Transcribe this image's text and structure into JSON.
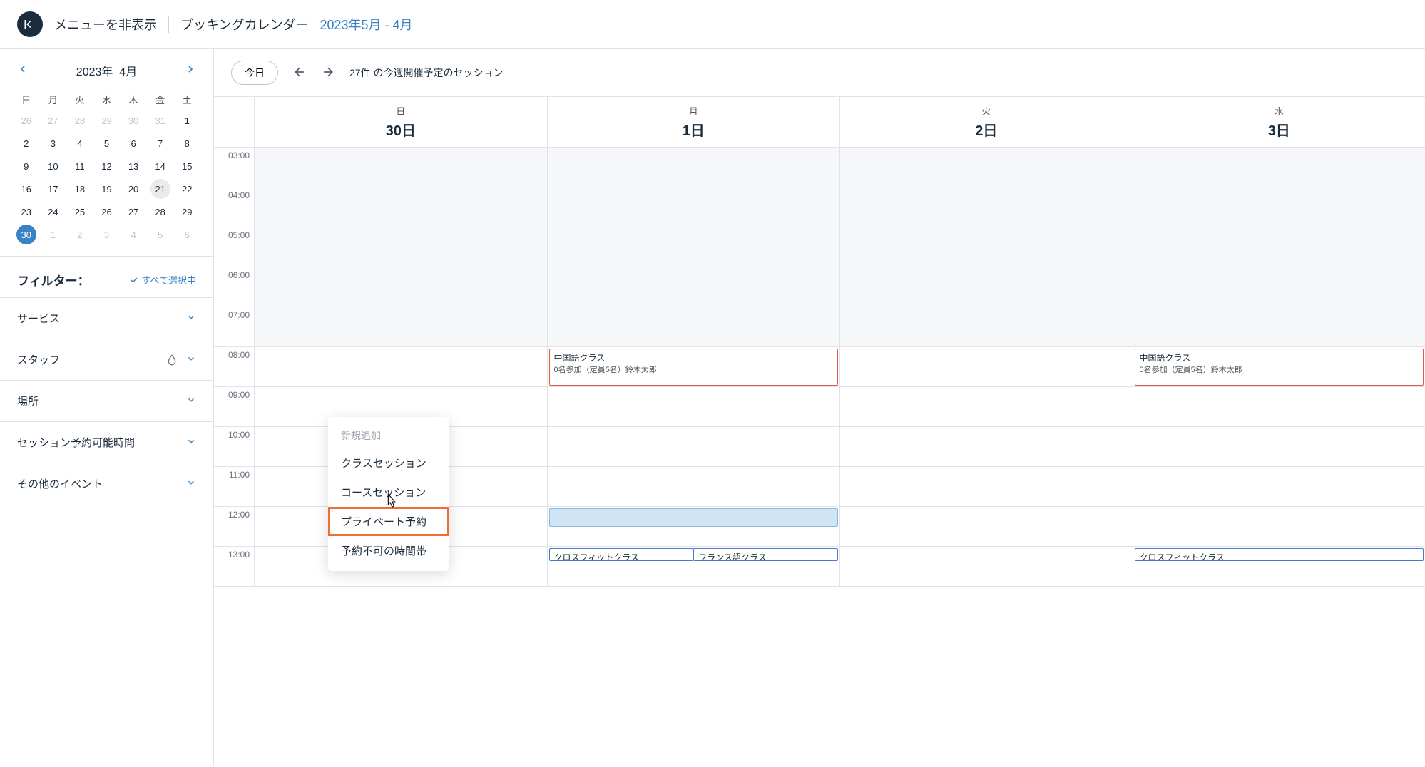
{
  "header": {
    "hide_menu": "メニューを非表示",
    "title": "ブッキングカレンダー",
    "date_range": "2023年5月 - 4月"
  },
  "mini_calendar": {
    "year_label": "2023年",
    "month_label": "4月",
    "dow": [
      "日",
      "月",
      "火",
      "水",
      "木",
      "金",
      "土"
    ],
    "weeks": [
      [
        {
          "d": "26",
          "o": true
        },
        {
          "d": "27",
          "o": true
        },
        {
          "d": "28",
          "o": true
        },
        {
          "d": "29",
          "o": true
        },
        {
          "d": "30",
          "o": true
        },
        {
          "d": "31",
          "o": true
        },
        {
          "d": "1"
        }
      ],
      [
        {
          "d": "2"
        },
        {
          "d": "3"
        },
        {
          "d": "4"
        },
        {
          "d": "5"
        },
        {
          "d": "6"
        },
        {
          "d": "7"
        },
        {
          "d": "8"
        }
      ],
      [
        {
          "d": "9"
        },
        {
          "d": "10"
        },
        {
          "d": "11"
        },
        {
          "d": "12"
        },
        {
          "d": "13"
        },
        {
          "d": "14"
        },
        {
          "d": "15"
        }
      ],
      [
        {
          "d": "16"
        },
        {
          "d": "17"
        },
        {
          "d": "18"
        },
        {
          "d": "19"
        },
        {
          "d": "20"
        },
        {
          "d": "21",
          "today": true
        },
        {
          "d": "22"
        }
      ],
      [
        {
          "d": "23"
        },
        {
          "d": "24"
        },
        {
          "d": "25"
        },
        {
          "d": "26"
        },
        {
          "d": "27"
        },
        {
          "d": "28"
        },
        {
          "d": "29"
        }
      ],
      [
        {
          "d": "30",
          "sel": true
        },
        {
          "d": "1",
          "o": true
        },
        {
          "d": "2",
          "o": true
        },
        {
          "d": "3",
          "o": true
        },
        {
          "d": "4",
          "o": true
        },
        {
          "d": "5",
          "o": true
        },
        {
          "d": "6",
          "o": true
        }
      ]
    ]
  },
  "filters": {
    "title": "フィルター：",
    "select_all": "すべて選択中",
    "items": [
      {
        "label": "サービス",
        "icon": null
      },
      {
        "label": "スタッフ",
        "icon": "droplet"
      },
      {
        "label": "場所",
        "icon": null
      },
      {
        "label": "セッション予約可能時間",
        "icon": null
      },
      {
        "label": "その他のイベント",
        "icon": null
      }
    ]
  },
  "toolbar": {
    "today": "今日",
    "session_summary": "27件 の今週開催予定のセッション"
  },
  "week": {
    "columns": [
      {
        "dow": "日",
        "date": "30日"
      },
      {
        "dow": "月",
        "date": "1日"
      },
      {
        "dow": "火",
        "date": "2日"
      },
      {
        "dow": "水",
        "date": "3日"
      }
    ],
    "hours": [
      "03:00",
      "04:00",
      "05:00",
      "06:00",
      "07:00",
      "08:00",
      "09:00",
      "10:00",
      "11:00",
      "12:00",
      "13:00"
    ],
    "off_hours": [
      "03:00",
      "04:00",
      "05:00",
      "06:00",
      "07:00"
    ]
  },
  "events": {
    "mon_0800": {
      "title": "中国語クラス",
      "sub": "0名参加（定員5名）鈴木太郎"
    },
    "wed_0800": {
      "title": "中国語クラス",
      "sub": "0名参加（定員5名）鈴木太郎"
    },
    "mon_1300a": {
      "title": "クロスフィットクラス"
    },
    "mon_1300b": {
      "title": "フランス語クラス"
    },
    "wed_1300": {
      "title": "クロスフィットクラス"
    }
  },
  "context_menu": {
    "title": "新規追加",
    "items": [
      "クラスセッション",
      "コースセッション",
      "プライベート予約",
      "予約不可の時間帯"
    ],
    "highlighted_index": 2
  }
}
